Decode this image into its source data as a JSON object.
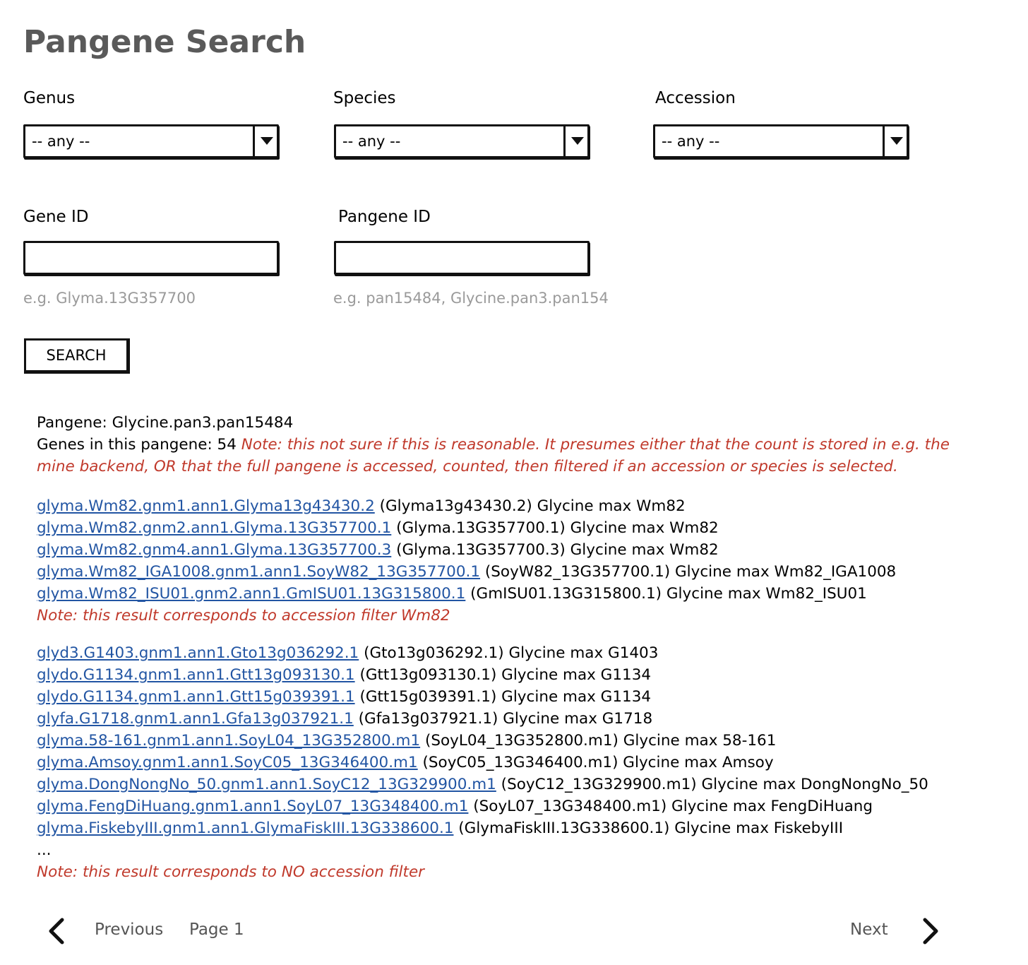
{
  "page": {
    "title": "Pangene Search"
  },
  "filters": {
    "genus": {
      "label": "Genus",
      "value": "-- any --"
    },
    "species": {
      "label": "Species",
      "value": "-- any --"
    },
    "accession": {
      "label": "Accession",
      "value": "-- any --"
    }
  },
  "fields": {
    "gene_id": {
      "label": "Gene ID",
      "value": "",
      "hint": "e.g. Glyma.13G357700"
    },
    "pangene_id": {
      "label": "Pangene ID",
      "value": "",
      "hint": "e.g. pan15484, Glycine.pan3.pan154"
    }
  },
  "search_button": "SEARCH",
  "result_header": {
    "pangene_line": "Pangene: Glycine.pan3.pan15484",
    "count_prefix": "Genes in this pangene: 54 ",
    "count_note_1": "Note: this not sure if this is reasonable. It presumes either that the count is stored in e.g. the",
    "count_note_2": "mine backend, OR that the full pangene is accessed, counted, then filtered if an accession or species is selected."
  },
  "group1": {
    "rows": [
      {
        "link": "glyma.Wm82.gnm1.ann1.Glyma13g43430.2",
        "desc": " (Glyma13g43430.2) Glycine max Wm82"
      },
      {
        "link": "glyma.Wm82.gnm2.ann1.Glyma.13G357700.1",
        "desc": " (Glyma.13G357700.1) Glycine max Wm82"
      },
      {
        "link": "glyma.Wm82.gnm4.ann1.Glyma.13G357700.3",
        "desc": " (Glyma.13G357700.3) Glycine max Wm82"
      },
      {
        "link": "glyma.Wm82_IGA1008.gnm1.ann1.SoyW82_13G357700.1",
        "desc": " (SoyW82_13G357700.1) Glycine max Wm82_IGA1008"
      },
      {
        "link": "glyma.Wm82_ISU01.gnm2.ann1.GmISU01.13G315800.1",
        "desc": " (GmISU01.13G315800.1) Glycine max Wm82_ISU01"
      }
    ],
    "note": "Note: this result corresponds to accession filter Wm82"
  },
  "group2": {
    "rows": [
      {
        "link": "glyd3.G1403.gnm1.ann1.Gto13g036292.1",
        "desc": " (Gto13g036292.1) Glycine max G1403"
      },
      {
        "link": "glydo.G1134.gnm1.ann1.Gtt13g093130.1",
        "desc": " (Gtt13g093130.1) Glycine max G1134"
      },
      {
        "link": "glydo.G1134.gnm1.ann1.Gtt15g039391.1",
        "desc": " (Gtt15g039391.1) Glycine max G1134"
      },
      {
        "link": "glyfa.G1718.gnm1.ann1.Gfa13g037921.1",
        "desc": " (Gfa13g037921.1) Glycine max G1718"
      },
      {
        "link": "glyma.58-161.gnm1.ann1.SoyL04_13G352800.m1",
        "desc": " (SoyL04_13G352800.m1) Glycine max 58-161"
      },
      {
        "link": "glyma.Amsoy.gnm1.ann1.SoyC05_13G346400.m1",
        "desc": " (SoyC05_13G346400.m1) Glycine max Amsoy"
      },
      {
        "link": "glyma.DongNongNo_50.gnm1.ann1.SoyC12_13G329900.m1",
        "desc": " (SoyC12_13G329900.m1) Glycine max DongNongNo_50"
      },
      {
        "link": "glyma.FengDiHuang.gnm1.ann1.SoyL07_13G348400.m1",
        "desc": " (SoyL07_13G348400.m1) Glycine max FengDiHuang"
      },
      {
        "link": "glyma.FiskebyIII.gnm1.ann1.GlymaFiskIII.13G338600.1",
        "desc": " (GlymaFiskIII.13G338600.1) Glycine max FiskebyIII"
      }
    ],
    "ellipsis": "...",
    "note": "Note: this result corresponds to NO accession filter"
  },
  "pager": {
    "previous": "Previous",
    "page": "Page 1",
    "next": "Next"
  }
}
